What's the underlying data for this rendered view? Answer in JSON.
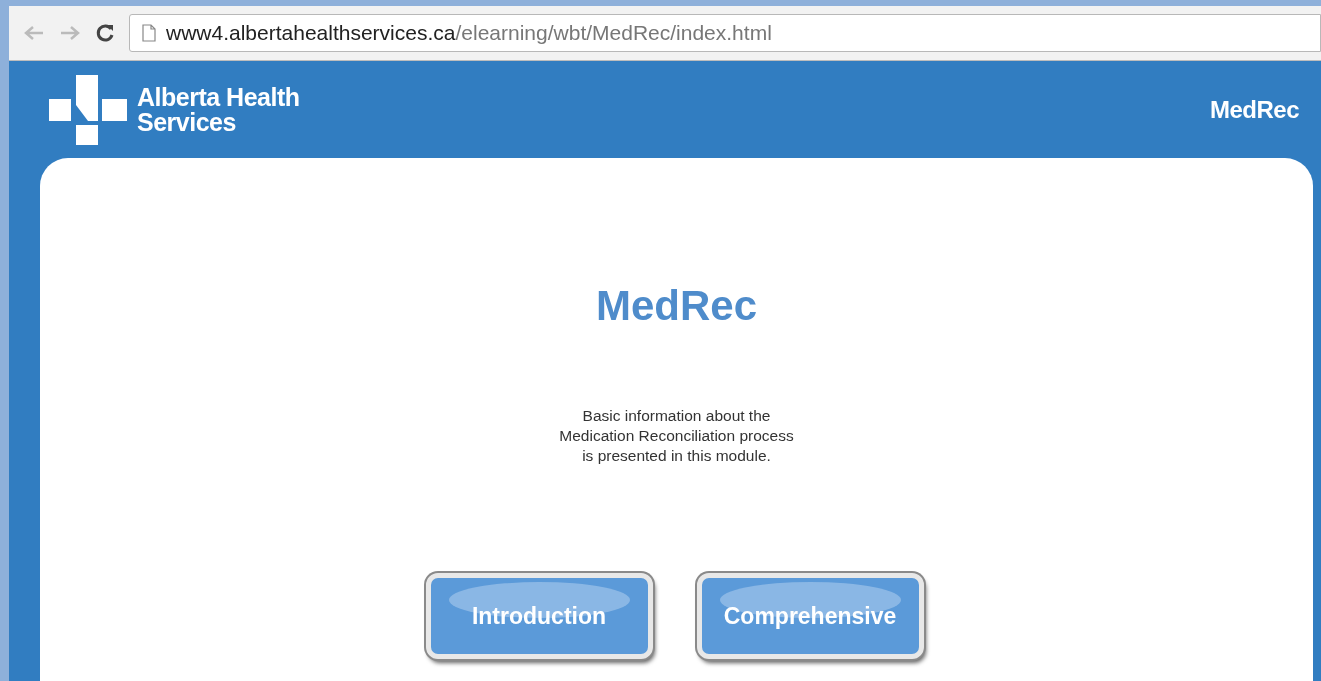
{
  "browser": {
    "url": {
      "host": "www4.albertahealthservices.ca",
      "path": "/elearning/wbt/MedRec/index.html"
    }
  },
  "header": {
    "logo_lines": [
      "Alberta Health",
      "Services"
    ],
    "title": "MedRec"
  },
  "content": {
    "title": "MedRec",
    "description_lines": [
      "Basic information about the",
      "Medication Reconciliation process",
      "is presented in this module."
    ],
    "buttons": [
      "Introduction",
      "Comprehensive"
    ]
  }
}
